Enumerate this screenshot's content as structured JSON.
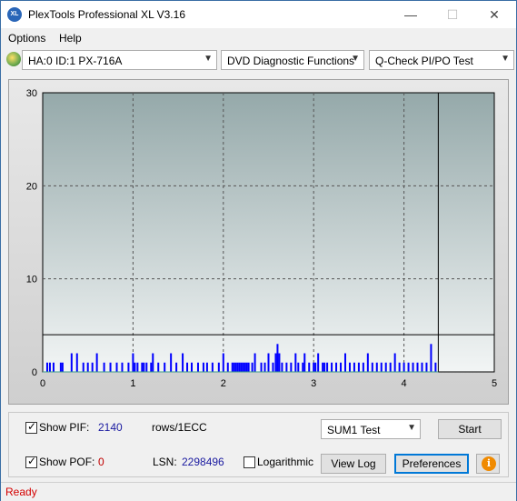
{
  "window": {
    "title": "PlexTools Professional XL V3.16",
    "icon_label": "XL"
  },
  "menu": [
    {
      "label": "Options"
    },
    {
      "label": "Help"
    }
  ],
  "toolbar": {
    "drive": "HA:0 ID:1  PX-716A",
    "function": "DVD Diagnostic Functions",
    "test": "Q-Check PI/PO Test"
  },
  "chart_data": {
    "type": "bar",
    "x_ticks": [
      "0",
      "1",
      "2",
      "3",
      "4",
      "5"
    ],
    "y_ticks": [
      "0",
      "10",
      "20",
      "30"
    ],
    "xlim": [
      0,
      5
    ],
    "ylim": [
      0,
      30
    ],
    "grid": true,
    "threshold_y": 4,
    "end_x": 4.38,
    "series": [
      {
        "color": "#0000ff",
        "values": [
          [
            0.05,
            1
          ],
          [
            0.08,
            1
          ],
          [
            0.12,
            1
          ],
          [
            0.2,
            1
          ],
          [
            0.22,
            1
          ],
          [
            0.32,
            2
          ],
          [
            0.38,
            2
          ],
          [
            0.45,
            1
          ],
          [
            0.5,
            1
          ],
          [
            0.55,
            1
          ],
          [
            0.6,
            2
          ],
          [
            0.68,
            1
          ],
          [
            0.75,
            1
          ],
          [
            0.82,
            1
          ],
          [
            0.88,
            1
          ],
          [
            0.95,
            1
          ],
          [
            1.0,
            2
          ],
          [
            1.02,
            1
          ],
          [
            1.05,
            1
          ],
          [
            1.1,
            1
          ],
          [
            1.12,
            1
          ],
          [
            1.15,
            1
          ],
          [
            1.2,
            1
          ],
          [
            1.22,
            2
          ],
          [
            1.28,
            1
          ],
          [
            1.35,
            1
          ],
          [
            1.42,
            2
          ],
          [
            1.48,
            1
          ],
          [
            1.55,
            2
          ],
          [
            1.6,
            1
          ],
          [
            1.65,
            1
          ],
          [
            1.72,
            1
          ],
          [
            1.78,
            1
          ],
          [
            1.82,
            1
          ],
          [
            1.88,
            1
          ],
          [
            1.95,
            1
          ],
          [
            2.0,
            2
          ],
          [
            2.05,
            1
          ],
          [
            2.1,
            1
          ],
          [
            2.12,
            1
          ],
          [
            2.14,
            1
          ],
          [
            2.16,
            1
          ],
          [
            2.18,
            1
          ],
          [
            2.2,
            1
          ],
          [
            2.22,
            1
          ],
          [
            2.24,
            1
          ],
          [
            2.26,
            1
          ],
          [
            2.28,
            1
          ],
          [
            2.32,
            1
          ],
          [
            2.35,
            2
          ],
          [
            2.42,
            1
          ],
          [
            2.46,
            1
          ],
          [
            2.5,
            2
          ],
          [
            2.55,
            1
          ],
          [
            2.58,
            2
          ],
          [
            2.6,
            3
          ],
          [
            2.62,
            2
          ],
          [
            2.65,
            1
          ],
          [
            2.7,
            1
          ],
          [
            2.75,
            1
          ],
          [
            2.8,
            2
          ],
          [
            2.83,
            1
          ],
          [
            2.88,
            1
          ],
          [
            2.9,
            2
          ],
          [
            2.95,
            1
          ],
          [
            3.0,
            1
          ],
          [
            3.02,
            1
          ],
          [
            3.05,
            2
          ],
          [
            3.1,
            1
          ],
          [
            3.12,
            1
          ],
          [
            3.15,
            1
          ],
          [
            3.2,
            1
          ],
          [
            3.25,
            1
          ],
          [
            3.3,
            1
          ],
          [
            3.35,
            2
          ],
          [
            3.4,
            1
          ],
          [
            3.45,
            1
          ],
          [
            3.5,
            1
          ],
          [
            3.55,
            1
          ],
          [
            3.6,
            2
          ],
          [
            3.65,
            1
          ],
          [
            3.7,
            1
          ],
          [
            3.75,
            1
          ],
          [
            3.8,
            1
          ],
          [
            3.85,
            1
          ],
          [
            3.9,
            2
          ],
          [
            3.95,
            1
          ],
          [
            4.0,
            1
          ],
          [
            4.05,
            1
          ],
          [
            4.1,
            1
          ],
          [
            4.15,
            1
          ],
          [
            4.2,
            1
          ],
          [
            4.25,
            1
          ],
          [
            4.3,
            3
          ],
          [
            4.35,
            1
          ]
        ]
      }
    ]
  },
  "controls": {
    "show_pif": {
      "label": "Show PIF:",
      "value": "2140",
      "checked": true
    },
    "units": "rows/1ECC",
    "test_select": "SUM1 Test",
    "start": "Start",
    "show_pof": {
      "label": "Show POF:",
      "value": "0",
      "checked": true
    },
    "lsn_label": "LSN:",
    "lsn_value": "2298496",
    "logarithmic": {
      "label": "Logarithmic",
      "checked": false
    },
    "view_log": "View Log",
    "preferences": "Preferences",
    "info_icon_text": "i"
  },
  "status": "Ready"
}
